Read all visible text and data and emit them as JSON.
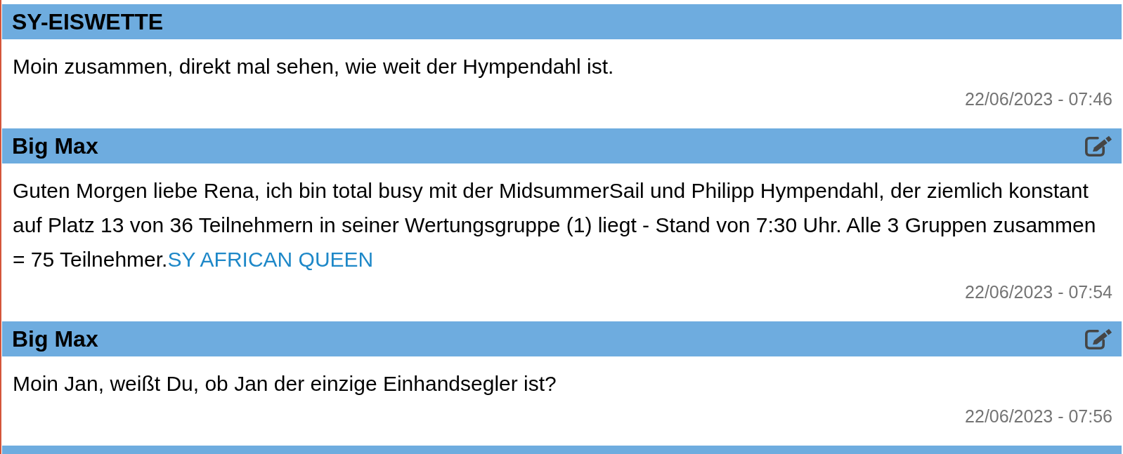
{
  "posts": [
    {
      "author": "SY-EISWETTE",
      "editable": false,
      "message": "Moin zusammen, direkt mal sehen, wie weit der Hympendahl ist.",
      "timestamp": "22/06/2023 - 07:46"
    },
    {
      "author": "Big Max",
      "editable": true,
      "message": "Guten Morgen liebe Rena, ich bin total busy mit der MidsummerSail und Philipp Hympendahl, der ziemlich konstant auf Platz 13 von 36 Teilnehmern in seiner Wertungsgruppe (1) liegt - Stand von 7:30 Uhr. Alle 3 Gruppen zusammen = 75 Teilnehmer.",
      "link": "SY AFRICAN QUEEN",
      "timestamp": "22/06/2023 - 07:54"
    },
    {
      "author": "Big Max",
      "editable": true,
      "message": "Moin Jan, weißt Du, ob Jan der einzige Einhandsegler ist?",
      "timestamp": "22/06/2023 - 07:56"
    }
  ]
}
